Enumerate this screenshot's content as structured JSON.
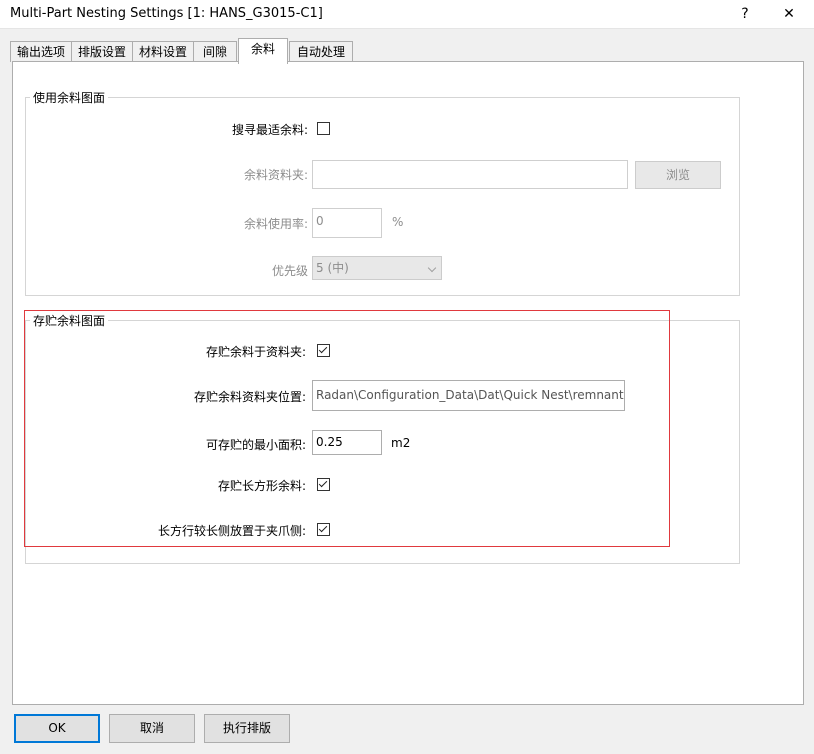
{
  "window": {
    "title": "Multi-Part Nesting Settings [1: HANS_G3015-C1]",
    "help_label": "?",
    "close_label": "✕"
  },
  "tabs": [
    {
      "label": "输出选项",
      "active": false
    },
    {
      "label": "排版设置",
      "active": false
    },
    {
      "label": "材料设置",
      "active": false
    },
    {
      "label": "间隙",
      "active": false
    },
    {
      "label": "余料",
      "active": true
    },
    {
      "label": "自动处理",
      "active": false
    }
  ],
  "use_remnant": {
    "legend": "使用余料图面",
    "search_best": {
      "label": "搜寻最适余料:",
      "checked": false
    },
    "folder": {
      "label": "余料资料夹:",
      "value": "",
      "browse_label": "浏览"
    },
    "usage_rate": {
      "label": "余料使用率:",
      "value": "0",
      "unit": "%"
    },
    "priority": {
      "label": "优先级",
      "value": "5 (中)"
    }
  },
  "save_remnant": {
    "legend": "存贮余料图面",
    "save_to_folder": {
      "label": "存贮余料于资料夹:",
      "checked": true
    },
    "folder_location": {
      "label": "存贮余料资料夹位置:",
      "value": "Radan\\Configuration_Data\\Dat\\Quick Nest\\remnants"
    },
    "min_area": {
      "label": "可存贮的最小面积:",
      "value": "0.25",
      "unit": "m2"
    },
    "save_rectangular": {
      "label": "存贮长方形余料:",
      "checked": true
    },
    "long_side_clamp": {
      "label": "长方行较长侧放置于夹爪侧:",
      "checked": true
    }
  },
  "footer": {
    "ok_label": "OK",
    "cancel_label": "取消",
    "run_nest_label": "执行排版"
  },
  "colors": {
    "highlight": "#e0393e",
    "arrow": "#e0393e",
    "default_button_border": "#0078d7"
  }
}
